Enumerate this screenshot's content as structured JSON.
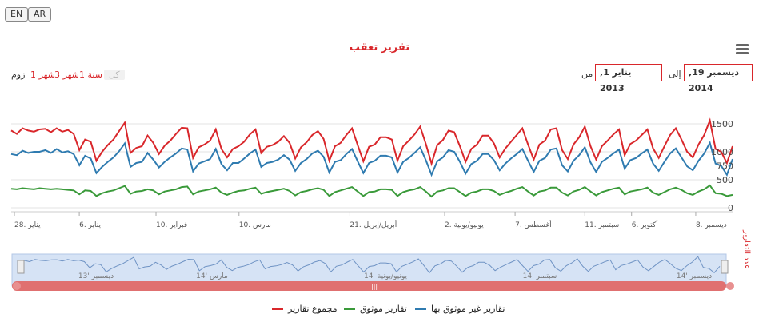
{
  "lang": {
    "en": "EN",
    "ar": "AR"
  },
  "title": "تقرير تعقب",
  "zoom": {
    "label": "زوم",
    "buttons": [
      "1 شهر",
      "3 شهر",
      "1 سنة",
      "كل"
    ]
  },
  "range": {
    "from_label": "من",
    "to_label": "إلى",
    "from_value": "يناير 1, 2013",
    "to_value": "ديسمبر 19, 2014"
  },
  "y_axis_title": "عدد التقارير",
  "legend": [
    {
      "label": "مجموع تقارير",
      "color": "#d9272b"
    },
    {
      "label": "تقارير موثوق",
      "color": "#3a9a3a"
    },
    {
      "label": "تقارير غير موثوق بها",
      "color": "#2f7bb0"
    }
  ],
  "navigator_labels": [
    "13' ديسمبر",
    "14' مارس",
    "14' يونيو/يونية",
    "14' سبتمبر",
    "14' ديسمبر"
  ],
  "chart_data": {
    "type": "line",
    "ylim": [
      0,
      1600
    ],
    "y_ticks": [
      0,
      250,
      500,
      750,
      1000,
      1250,
      1500
    ],
    "y_tick_labels": [
      "0",
      "",
      "500",
      "750",
      "1000",
      "",
      "1500"
    ],
    "x_tick_labels": [
      "28. يناير",
      "6. يناير",
      "10. فبراير",
      "10. مارس",
      "21. أبريل/إبريل",
      "2. يونيو/يونية",
      "7. أغسطس",
      "11. سبتمبر",
      "6. أكتوبر",
      "8. ديسمبر"
    ],
    "x_tick_fracs": [
      0.0,
      0.093,
      0.203,
      0.322,
      0.481,
      0.617,
      0.718,
      0.818,
      0.885,
      0.977
    ],
    "series": [
      {
        "name": "مجموع تقارير",
        "color": "#d9272b",
        "values": [
          1380,
          1320,
          1420,
          1380,
          1360,
          1400,
          1410,
          1350,
          1420,
          1360,
          1390,
          1320,
          1030,
          1220,
          1180,
          840,
          1000,
          1120,
          1220,
          1370,
          1520,
          980,
          1070,
          1100,
          1290,
          1160,
          960,
          1110,
          1200,
          1320,
          1430,
          1420,
          890,
          1080,
          1130,
          1200,
          1400,
          1050,
          900,
          1050,
          1100,
          1180,
          1310,
          1400,
          980,
          1090,
          1120,
          1180,
          1280,
          1160,
          880,
          1080,
          1170,
          1300,
          1370,
          1230,
          840,
          1100,
          1160,
          1300,
          1420,
          1120,
          830,
          1090,
          1130,
          1260,
          1260,
          1220,
          840,
          1100,
          1200,
          1310,
          1450,
          1140,
          790,
          1120,
          1210,
          1380,
          1350,
          1100,
          820,
          1050,
          1130,
          1290,
          1290,
          1150,
          900,
          1060,
          1180,
          1300,
          1420,
          1130,
          860,
          1130,
          1200,
          1400,
          1420,
          1030,
          870,
          1130,
          1260,
          1450,
          1100,
          860,
          1100,
          1200,
          1310,
          1400,
          940,
          1140,
          1200,
          1300,
          1400,
          1060,
          890,
          1100,
          1300,
          1420,
          1220,
          1000,
          900,
          1130,
          1300,
          1560,
          1050,
          1000,
          800,
          1100
        ]
      },
      {
        "name": "تقارير موثوق",
        "color": "#3a9a3a",
        "values": [
          340,
          330,
          350,
          340,
          330,
          350,
          340,
          330,
          340,
          330,
          320,
          310,
          240,
          310,
          300,
          210,
          260,
          290,
          310,
          350,
          390,
          250,
          290,
          300,
          330,
          310,
          240,
          290,
          310,
          330,
          370,
          380,
          240,
          290,
          310,
          330,
          360,
          270,
          230,
          270,
          300,
          310,
          340,
          360,
          250,
          280,
          300,
          320,
          340,
          300,
          220,
          280,
          300,
          330,
          350,
          320,
          210,
          280,
          310,
          340,
          370,
          290,
          210,
          280,
          290,
          330,
          330,
          320,
          210,
          280,
          310,
          330,
          370,
          290,
          200,
          290,
          310,
          350,
          350,
          280,
          210,
          270,
          290,
          330,
          330,
          300,
          230,
          270,
          300,
          340,
          370,
          290,
          220,
          290,
          310,
          360,
          360,
          270,
          220,
          290,
          320,
          370,
          290,
          220,
          280,
          310,
          340,
          360,
          240,
          290,
          310,
          330,
          360,
          270,
          230,
          280,
          330,
          360,
          320,
          260,
          230,
          290,
          330,
          400,
          260,
          250,
          210,
          230
        ]
      },
      {
        "name": "تقارير غير موثوق بها",
        "color": "#2f7bb0",
        "values": [
          960,
          940,
          1020,
          980,
          1000,
          1000,
          1030,
          980,
          1050,
          990,
          1010,
          960,
          760,
          930,
          880,
          620,
          730,
          820,
          900,
          1010,
          1150,
          730,
          800,
          820,
          980,
          860,
          720,
          820,
          900,
          970,
          1060,
          1040,
          650,
          790,
          830,
          870,
          1050,
          780,
          670,
          800,
          800,
          880,
          970,
          1040,
          730,
          800,
          820,
          860,
          940,
          860,
          660,
          800,
          870,
          970,
          1020,
          910,
          630,
          820,
          850,
          960,
          1050,
          830,
          620,
          800,
          840,
          930,
          930,
          900,
          630,
          820,
          890,
          980,
          1080,
          850,
          590,
          830,
          900,
          1030,
          1000,
          820,
          610,
          780,
          840,
          960,
          960,
          850,
          670,
          790,
          880,
          960,
          1050,
          840,
          640,
          840,
          890,
          1040,
          1060,
          760,
          650,
          840,
          940,
          1080,
          810,
          640,
          820,
          890,
          970,
          1040,
          700,
          850,
          890,
          970,
          1040,
          790,
          660,
          820,
          970,
          1060,
          900,
          740,
          670,
          840,
          970,
          1160,
          790,
          750,
          590,
          870
        ]
      }
    ]
  }
}
